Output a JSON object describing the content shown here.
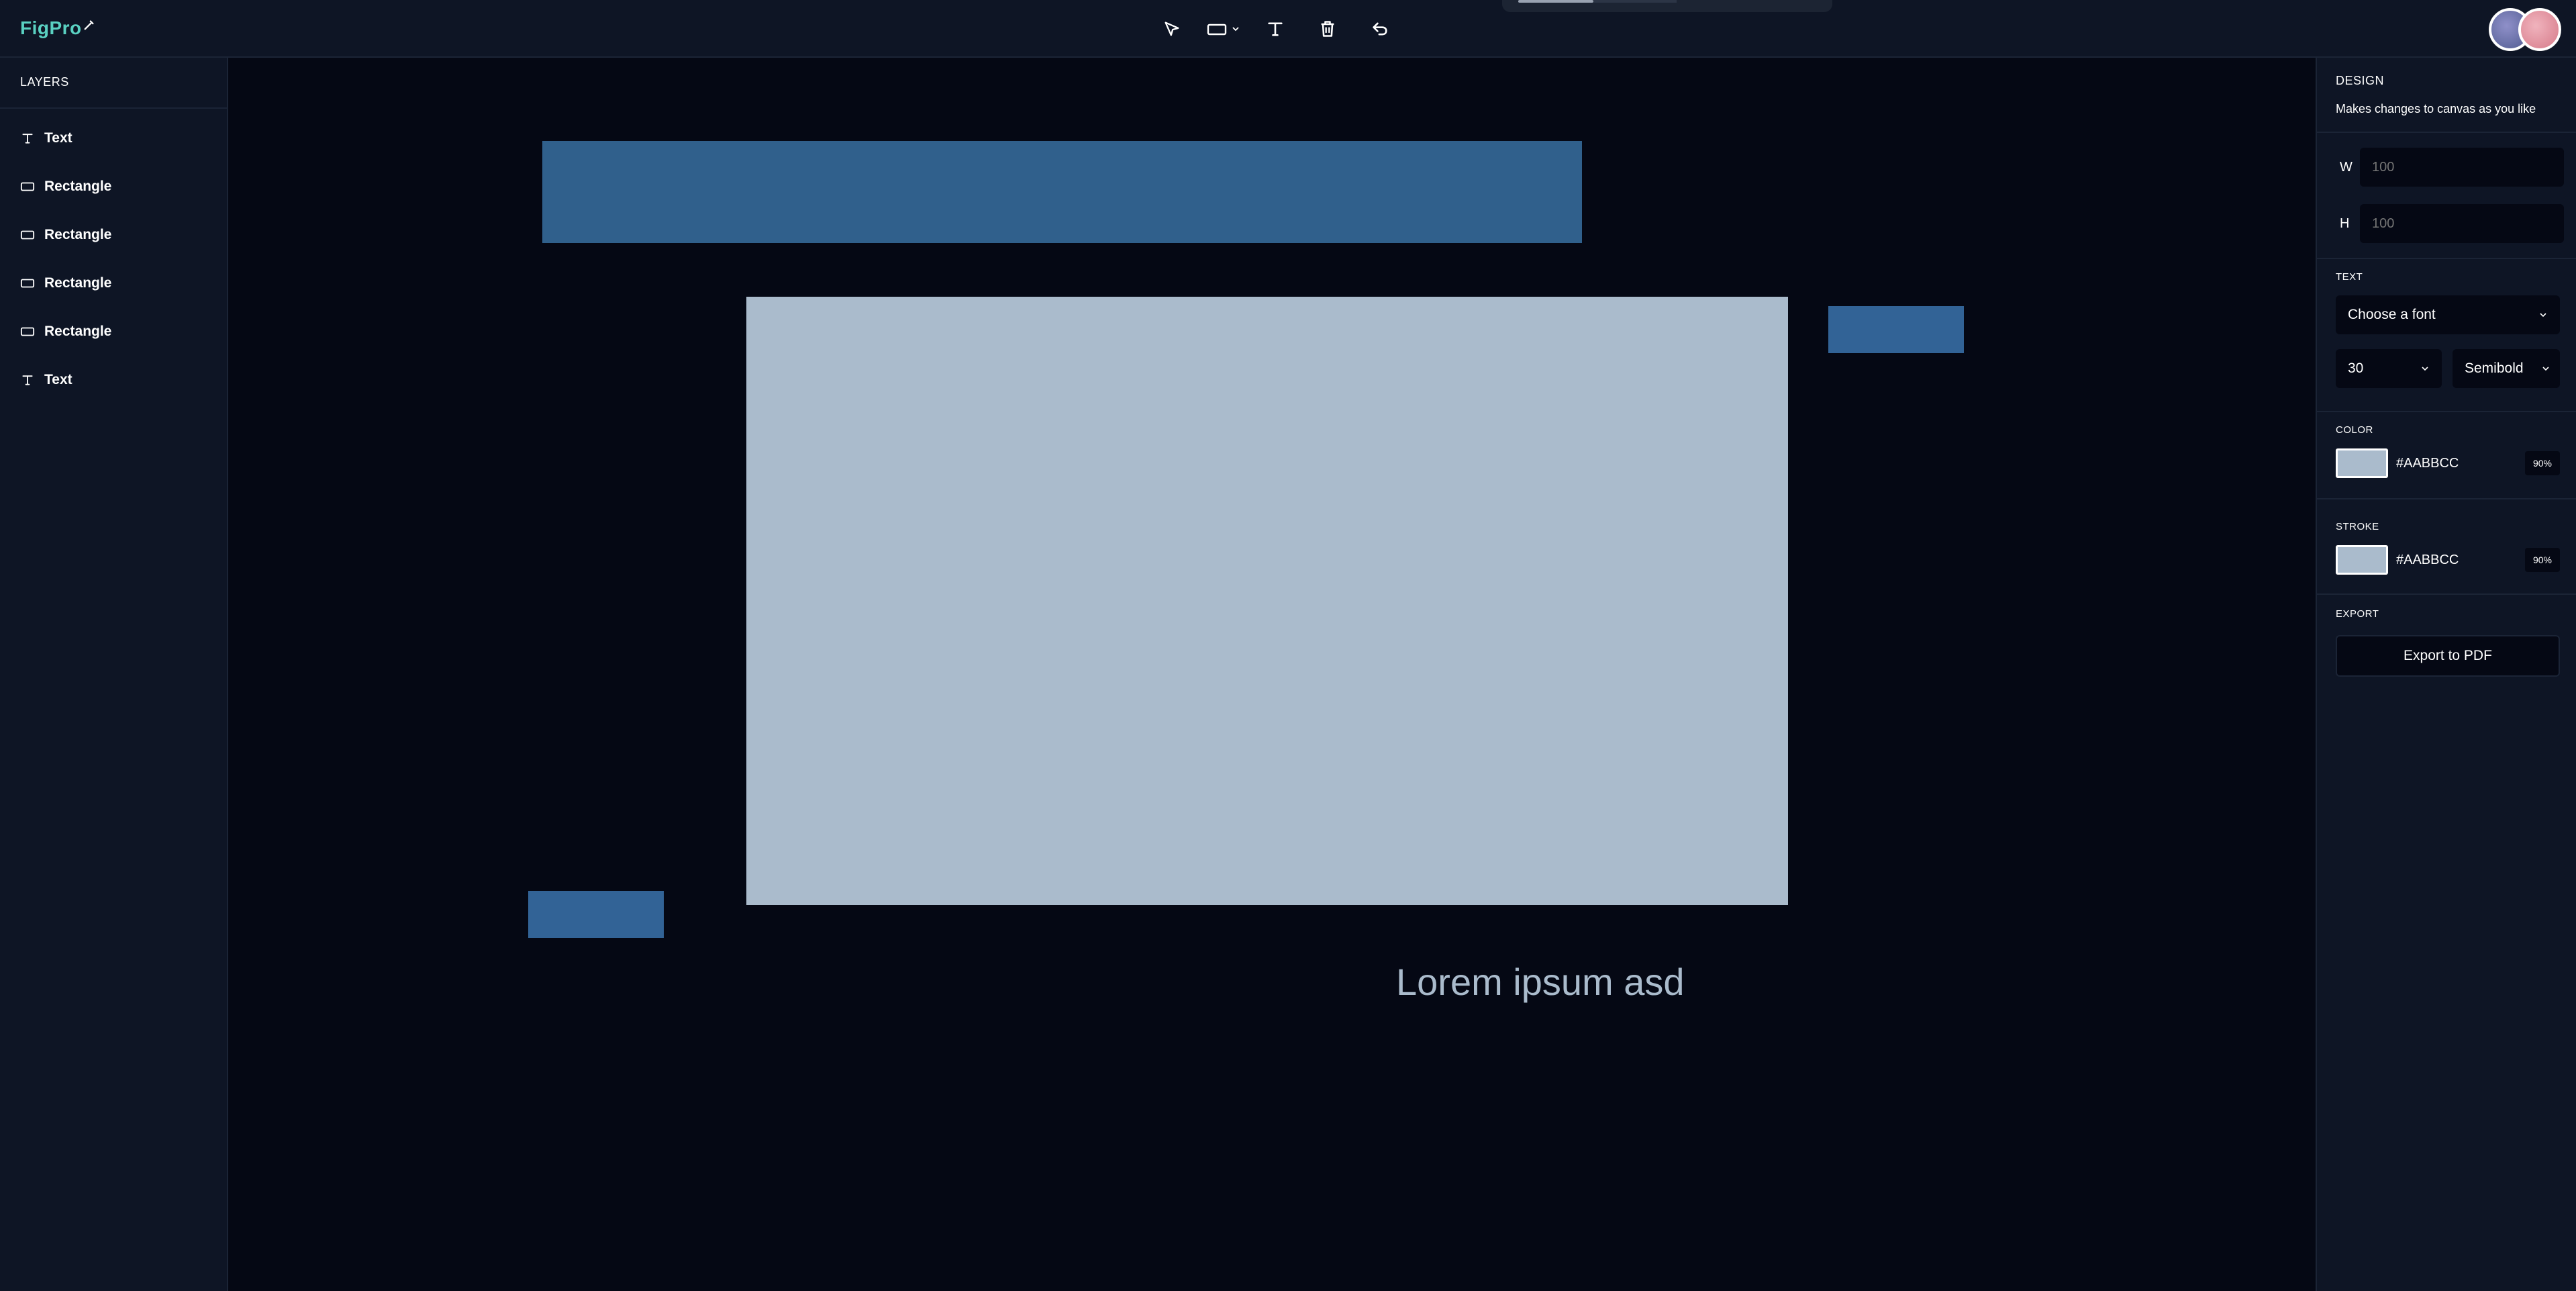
{
  "app": {
    "logo_text": "FigPro"
  },
  "toolbar": {
    "tools": [
      "select-tool",
      "rectangle-tool",
      "text-tool",
      "delete-tool",
      "undo-tool"
    ]
  },
  "layers": {
    "heading": "LAYERS",
    "items": [
      {
        "label": "Text",
        "icon": "text-icon"
      },
      {
        "label": "Rectangle",
        "icon": "rectangle-icon"
      },
      {
        "label": "Rectangle",
        "icon": "rectangle-icon"
      },
      {
        "label": "Rectangle",
        "icon": "rectangle-icon"
      },
      {
        "label": "Rectangle",
        "icon": "rectangle-icon"
      },
      {
        "label": "Text",
        "icon": "text-icon"
      }
    ]
  },
  "canvas": {
    "text_object": "Lorem ipsum asd",
    "colors": {
      "background": "#050814",
      "rect_dark": "#30608c",
      "rect_light": "#aabbcc"
    }
  },
  "design": {
    "title": "DESIGN",
    "subtitle": "Makes changes to canvas as you like",
    "width_label": "W",
    "width_placeholder": "100",
    "height_label": "H",
    "height_placeholder": "100",
    "text_section": "TEXT",
    "font_placeholder": "Choose a font",
    "font_size": "30",
    "font_weight": "Semibold",
    "color_section": "COLOR",
    "fill_hex": "#AABBCC",
    "fill_opacity": "90%",
    "stroke_section": "STROKE",
    "stroke_hex": "#AABBCC",
    "stroke_opacity": "90%",
    "export_section": "EXPORT",
    "export_button": "Export to PDF"
  }
}
